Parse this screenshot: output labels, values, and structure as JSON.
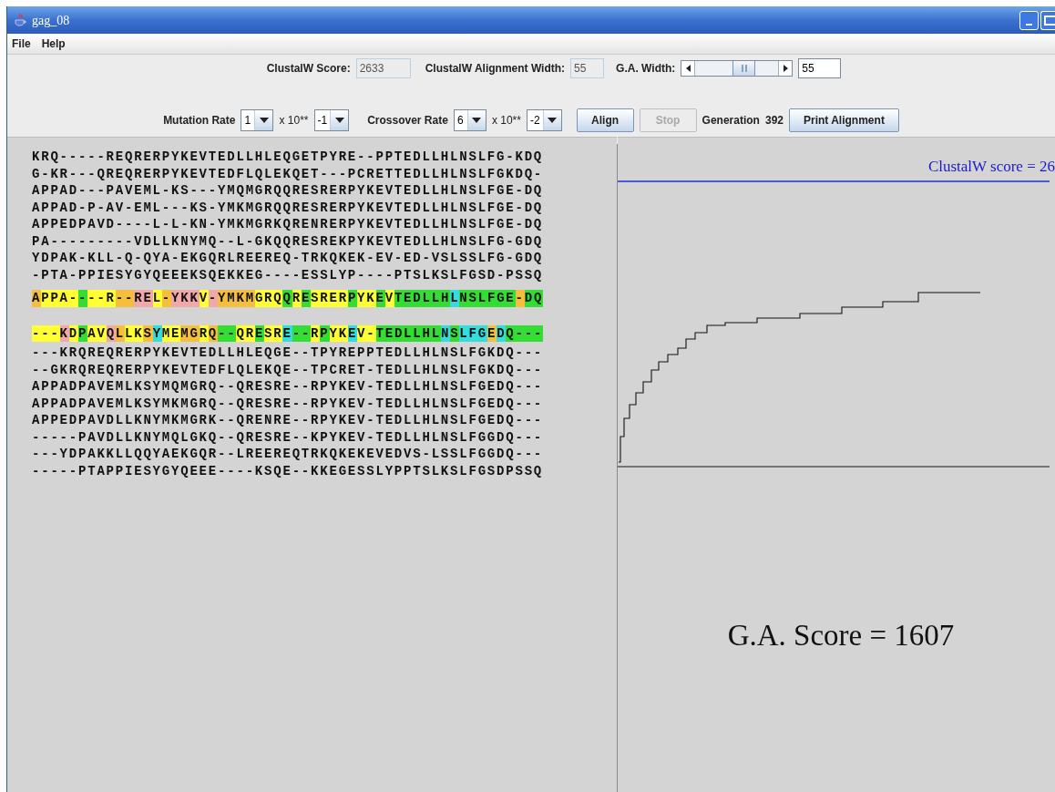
{
  "window": {
    "title": "gag_08"
  },
  "menu": [
    "File",
    "Help"
  ],
  "score_row": {
    "clustal_label": "ClustalW Score:",
    "clustal_value": "2633",
    "width_label": "ClustalW Alignment Width:",
    "width_value": "55",
    "ga_label": "G.A. Width:",
    "ga_value": "55"
  },
  "rate_row": {
    "mutation_label": "Mutation Rate",
    "mutation_mantissa": "1",
    "mutation_times": "x 10**",
    "mutation_exponent": "-1",
    "crossover_label": "Crossover Rate",
    "crossover_mantissa": "6",
    "crossover_times": "x 10**",
    "crossover_exponent": "-2",
    "buttons": [
      {
        "label": "Align",
        "disabled": false
      },
      {
        "label": "Stop",
        "disabled": true
      }
    ],
    "generation_label": "Generation",
    "generation_value": "392",
    "print_button": "Print Alignment"
  },
  "blocks": [
    {
      "kind": "rows",
      "rows": [
        "KRQ-----REQRERPYKEVTEDLLHLEQGETPYRE--PPTEDLLHLNSLFG-KDQ",
        "G-KR---QREQRERPYKEVTEDFLQLEKQET---PCRETTEDLLHLNSLFGKDQ-",
        "APPAD---PAVEML-KS---YMQMGRQQRESRERPYKEVTEDLLHLNSLFGE-DQ",
        "APPAD-P-AV-EML---KS-YMKMGRQQRESRERPYKEVTEDLLHLNSLFGE-DQ",
        "APPEDPAVD----L-L-KN-YMKMGRKQRENRERPYKEVTEDLLHLNSLFGE-DQ",
        "PA---------VDLLKNYMQ--L-GKQQRESREKPYKEVTEDLLHLNSLFG-GDQ",
        "YDPAK-KLL-Q-QYA-EKGQRLREEREQ-TRKQKEK-EV-ED-VSLSSLFG-GDQ",
        "-PTA-PPIESYGYQEEEKSQEKKEG----ESSLYP----PTSLKSLFGSD-PSSQ"
      ]
    },
    {
      "kind": "colored",
      "segments": [
        {
          "text": "A",
          "color": "#f5be3c"
        },
        {
          "text": "PPA-",
          "color": "#ffff33"
        },
        {
          "text": "-",
          "color": "#33dd33"
        },
        {
          "text": "--R",
          "color": "#ffff33"
        },
        {
          "text": "--",
          "color": "#f5be3c"
        },
        {
          "text": "RE",
          "color": "#f0a8a8"
        },
        {
          "text": "L",
          "color": "#ffff33"
        },
        {
          "text": "-",
          "color": "#f5be3c"
        },
        {
          "text": "YKK",
          "color": "#f0a8a8"
        },
        {
          "text": "V",
          "color": "#ffff33"
        },
        {
          "text": "-",
          "color": "#f0a8a8"
        },
        {
          "text": "YMKM",
          "color": "#f5be3c"
        },
        {
          "text": "GRQ",
          "color": "#ffff33"
        },
        {
          "text": "Q",
          "color": "#33dd33"
        },
        {
          "text": "R",
          "color": "#ffff33"
        },
        {
          "text": "E",
          "color": "#33dd33"
        },
        {
          "text": "SRER",
          "color": "#ffff33"
        },
        {
          "text": "P",
          "color": "#33dd33"
        },
        {
          "text": "YK",
          "color": "#ffff33"
        },
        {
          "text": "E",
          "color": "#33dd33"
        },
        {
          "text": "V",
          "color": "#ffff33"
        },
        {
          "text": "TEDLLH",
          "color": "#33dd33"
        },
        {
          "text": "L",
          "color": "#33dddd"
        },
        {
          "text": "NSLFGE",
          "color": "#33dd33"
        },
        {
          "text": "-",
          "color": "#f5be3c"
        },
        {
          "text": "DQ",
          "color": "#33dd33"
        }
      ]
    },
    {
      "kind": "colored",
      "segments": [
        {
          "text": "---",
          "color": "#ffff33"
        },
        {
          "text": "K",
          "color": "#f0a8a8"
        },
        {
          "text": "D",
          "color": "#ffff33"
        },
        {
          "text": "P",
          "color": "#33dd33"
        },
        {
          "text": "AV",
          "color": "#ffff33"
        },
        {
          "text": "Q",
          "color": "#f0a8a8"
        },
        {
          "text": "L",
          "color": "#f5be3c"
        },
        {
          "text": "LK",
          "color": "#ffff33"
        },
        {
          "text": "S",
          "color": "#f5be3c"
        },
        {
          "text": "Y",
          "color": "#33dddd"
        },
        {
          "text": "ME",
          "color": "#ffff33"
        },
        {
          "text": "MG",
          "color": "#f5be3c"
        },
        {
          "text": "R",
          "color": "#ffff33"
        },
        {
          "text": "Q",
          "color": "#f5be3c"
        },
        {
          "text": "--",
          "color": "#33dd33"
        },
        {
          "text": "QR",
          "color": "#ffff33"
        },
        {
          "text": "E",
          "color": "#33dd33"
        },
        {
          "text": "SR",
          "color": "#ffff33"
        },
        {
          "text": "E",
          "color": "#33dddd"
        },
        {
          "text": "--",
          "color": "#33dd33"
        },
        {
          "text": "R",
          "color": "#ffff33"
        },
        {
          "text": "P",
          "color": "#33dd33"
        },
        {
          "text": "YK",
          "color": "#ffff33"
        },
        {
          "text": "E",
          "color": "#33dddd"
        },
        {
          "text": "V-",
          "color": "#ffff33"
        },
        {
          "text": "TEDLLHL",
          "color": "#33dd33"
        },
        {
          "text": "N",
          "color": "#33dddd"
        },
        {
          "text": "S",
          "color": "#33dd33"
        },
        {
          "text": "LFG",
          "color": "#33dddd"
        },
        {
          "text": "E",
          "color": "#f5be3c"
        },
        {
          "text": "D",
          "color": "#33dddd"
        },
        {
          "text": "Q---",
          "color": "#33dd33"
        }
      ]
    },
    {
      "kind": "rows",
      "rows": [
        "---KRQREQRERPYKEVTEDLLHLEQGE--TPYREPPTEDLLHLNSLFGKDQ---",
        "--GKRQREQRERPYKEVTEDFLQLEKQE--TPCRET-TEDLLHLNSLFGKDQ---",
        "APPADPAVEMLKSYMQMGRQ--QRESRE--RPYKEV-TEDLLHLNSLFGEDQ---",
        "APPADPAVEMLKSYMKMGRQ--QRESRE--RPYKEV-TEDLLHLNSLFGEDQ---",
        "APPEDPAVDLLKNYMKMGRK--QRENRE--RPYKEV-TEDLLHLNSLFGEDQ---",
        "-----PAVDLLKNYMQLGKQ--QRESRE--KPYKEV-TEDLLHLNSLFGGDQ---",
        "---YDPAKKLLQQYAEKGQR--LREEREQTRKQKEKEVEDVS-LSSLFGGDQ---",
        "-----PTAPPIESYGYQEEE----KSQE--KKEGESSLYPPTSLKSLFGSDPSSQ"
      ]
    }
  ],
  "chart": {
    "reference_label": "ClustalW score = 26",
    "score_label": "G.A. Score = 1607"
  }
}
